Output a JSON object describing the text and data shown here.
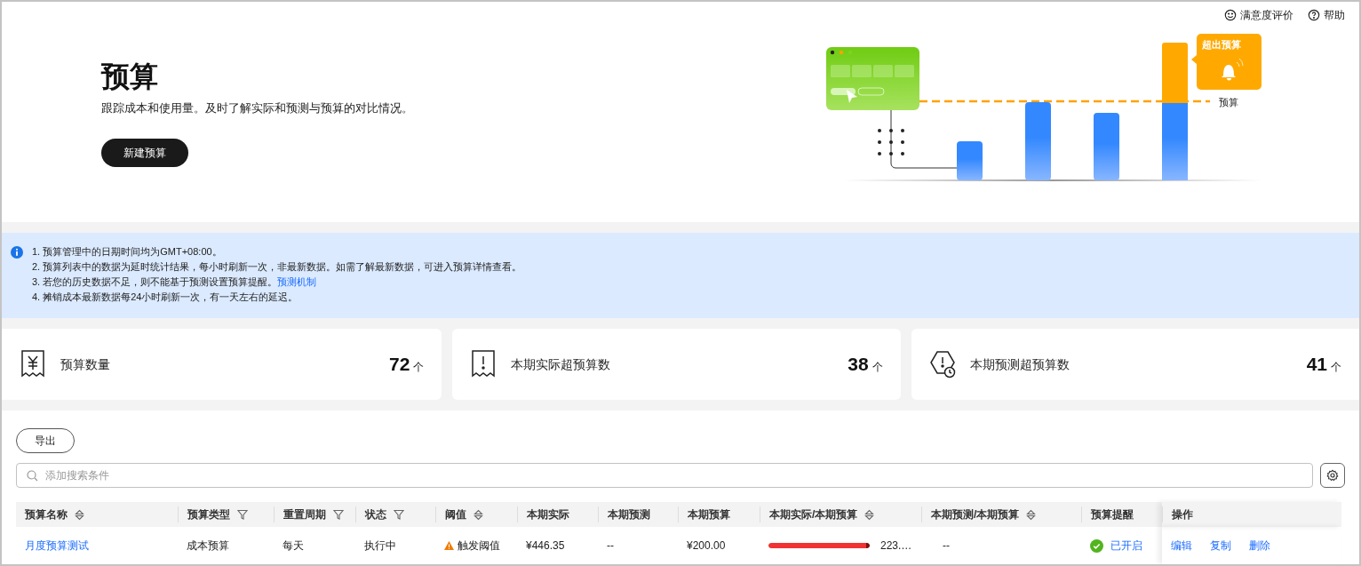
{
  "header_links": [
    {
      "kind": "smile",
      "label": "满意度评价"
    },
    {
      "kind": "help",
      "label": "帮助"
    }
  ],
  "hero": {
    "title": "预算",
    "subtitle": "跟踪成本和使用量。及时了解实际和预测与预算的对比情况。",
    "button": "新建预算"
  },
  "illustration": {
    "badge": "超出预算",
    "line_label": "预算"
  },
  "notice": [
    {
      "text": "1. 预算管理中的日期时间均为GMT+08:00。"
    },
    {
      "text": "2. 预算列表中的数据为延时统计结果，每小时刷新一次，非最新数据。如需了解最新数据，可进入预算详情查看。"
    },
    {
      "text": "3. 若您的历史数据不足，则不能基于预测设置预算提醒。",
      "link": "预测机制"
    },
    {
      "text": "4. 摊销成本最新数据每24小时刷新一次，有一天左右的延迟。"
    }
  ],
  "stats": [
    {
      "kind": "yuan",
      "label": "预算数量",
      "value": "72",
      "unit": "个"
    },
    {
      "kind": "alert",
      "label": "本期实际超预算数",
      "value": "38",
      "unit": "个"
    },
    {
      "kind": "forecast",
      "label": "本期预测超预算数",
      "value": "41",
      "unit": "个"
    }
  ],
  "export_button": "导出",
  "search": {
    "placeholder": "添加搜索条件"
  },
  "table": {
    "columns": [
      {
        "label": "预算名称",
        "kind": "sort"
      },
      {
        "label": "预算类型",
        "kind": "filter"
      },
      {
        "label": "重置周期",
        "kind": "filter"
      },
      {
        "label": "状态",
        "kind": "filter"
      },
      {
        "label": "阈值",
        "kind": "sort"
      },
      {
        "label": "本期实际",
        "kind": "plain"
      },
      {
        "label": "本期预测",
        "kind": "plain"
      },
      {
        "label": "本期预算",
        "kind": "plain"
      },
      {
        "label": "本期实际/本期预算",
        "kind": "sort"
      },
      {
        "label": "本期预测/本期预算",
        "kind": "sort"
      },
      {
        "label": "预算提醒",
        "kind": "plain"
      },
      {
        "label": "操作",
        "kind": "plain"
      }
    ],
    "rows": [
      {
        "name": "月度预算测试",
        "type": "成本预算",
        "period": "每天",
        "status": "执行中",
        "threshold": "触发阈值",
        "threshold_warning": true,
        "actual": "¥446.35",
        "forecast": "--",
        "budget": "¥200.00",
        "actual_ratio": {
          "level": 1,
          "reading": "223.…"
        },
        "forecast_ratio": "--",
        "reminder": {
          "on": true,
          "label": "已开启"
        },
        "actions": [
          "编辑",
          "复制",
          "删除"
        ]
      }
    ]
  }
}
